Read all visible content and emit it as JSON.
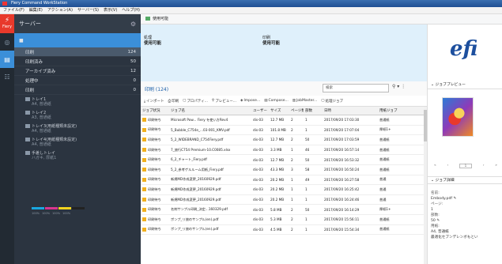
{
  "window": {
    "title": "Fiery Command WorkStation"
  },
  "menu": [
    "ファイル(F)",
    "編集(E)",
    "アクション(A)",
    "サーバー(S)",
    "表示(V)",
    "ヘルプ(H)"
  ],
  "rail": {
    "logo_label": "Fiery"
  },
  "sidebar": {
    "title": "サーバー",
    "server_name": "■",
    "items": [
      {
        "label": "印刷",
        "count": "124"
      },
      {
        "label": "印刷済み",
        "count": "50"
      },
      {
        "label": "アーカイブ済み",
        "count": "12"
      },
      {
        "label": "処理中",
        "count": "0"
      },
      {
        "label": "印刷",
        "count": "0"
      }
    ],
    "printers": [
      {
        "name": "トレイ1",
        "sub": "A4, 普通紙"
      },
      {
        "name": "トレイ2",
        "sub": "A3, 普通紙"
      },
      {
        "name": "トレイ3(用紙種類未設定)",
        "sub": "A4, 普通紙"
      },
      {
        "name": "トレイ4(用紙種類未設定)",
        "sub": "A4, 普通紙"
      },
      {
        "name": "手差しトレイ",
        "sub": "ハガキ, 厚紙1"
      }
    ],
    "ink": {
      "colors": [
        "#19a7e0",
        "#d8368f",
        "#f2d31e",
        "#222222"
      ],
      "percents": [
        "100%",
        "100%",
        "100%",
        "100%"
      ]
    }
  },
  "pathbar": {
    "label": "使用可能"
  },
  "status": [
    {
      "label": "処理",
      "value": "使用可能"
    },
    {
      "label": "印刷",
      "value": "使用可能"
    }
  ],
  "brand": "efi",
  "list": {
    "title": "印刷 (124)",
    "search_placeholder": "検索"
  },
  "toolbar": [
    {
      "icon": "⤓",
      "label": "インポート"
    },
    {
      "icon": "⎙",
      "label": "印刷"
    },
    {
      "icon": "▢",
      "label": "プロパティ..."
    },
    {
      "icon": "⚲",
      "label": "プレビュー..."
    },
    {
      "icon": "◈",
      "label": "Impose..."
    },
    {
      "icon": "▤",
      "label": "Compose..."
    },
    {
      "icon": "▥",
      "label": "JobMaster..."
    },
    {
      "icon": "▢",
      "label": "処理ジョブ"
    }
  ],
  "table": {
    "headers": [
      "ジョブ状況",
      "ジョブ名",
      "ユーザー",
      "サイズ",
      "ページ数",
      "部数",
      "日時",
      "用紙ジョブ"
    ],
    "rows": [
      [
        "印刷待ち",
        "Microsoft Pow... Fiery を使い方Rev4",
        "dis-03",
        "12.7 MB",
        "2",
        "1",
        "2017/09/20 17:03:30",
        "普通紙"
      ],
      [
        "印刷待ち",
        "5_Bubble_C754e_...03-001_KMV.pdf",
        "dis-03",
        "101.8 MB",
        "2",
        "1",
        "2017/09/20 17:07:04",
        "厚紙1+"
      ],
      [
        "印刷待ち",
        "5_2_WIDEBRAND_C754Fiery.pdf",
        "dis-03",
        "12.7 MB",
        "2",
        "50",
        "2017/09/20 17:03:59",
        "普通紙"
      ],
      [
        "印刷待ち",
        "7_旅行C754 Premium-10.C0085.xlsx",
        "dis-03",
        "3.3 MB",
        "1",
        "46",
        "2017/09/20 16:57:14",
        "普通紙"
      ],
      [
        "印刷待ち",
        "6_2_チャート_Fiery.pdf",
        "dis-03",
        "12.7 MB",
        "2",
        "50",
        "2017/09/20 16:53:32",
        "普通紙"
      ],
      [
        "印刷待ち",
        "5_2_参考ゲルルーム用紙_Fiery.pdf",
        "dis-03",
        "43.3 MB",
        "3",
        "58",
        "2017/09/20 16:50:24",
        "普通紙"
      ],
      [
        "印刷待ち",
        "新規MD作成変更_20160929.pdf",
        "dis-03",
        "20.2 MB",
        "1",
        "49",
        "2017/09/20 16:27:58",
        "普通"
      ],
      [
        "印刷待ち",
        "新規MD作成変更_20160929.pdf",
        "dis-03",
        "20.2 MB",
        "1",
        "1",
        "2017/09/20 16:25:42",
        "普通"
      ],
      [
        "印刷待ち",
        "新規MD作成変更_20160929.pdf",
        "dis-03",
        "20.2 MB",
        "1",
        "1",
        "2017/09/20 16:24:46",
        "普通"
      ],
      [
        "印刷待ち",
        "名刺サンプル印刷_決定...160329.pdf",
        "dis-03",
        "5.8 MB",
        "2",
        "50",
        "2017/09/20 16:14:29",
        "厚紙1+"
      ],
      [
        "印刷待ち",
        "ポンプ_リ旅のサンプル(en).pdf",
        "dis-03",
        "5.3 MB",
        "2",
        "1",
        "2017/09/20 15:56:11",
        "普通紙"
      ],
      [
        "印刷待ち",
        "ポンプ_リ旅のサンプル(en).pdf",
        "dis-03",
        "4.5 MB",
        "2",
        "1",
        "2017/09/20 15:54:34",
        "普通紙"
      ]
    ]
  },
  "right": {
    "preview_title": "ジョブプレビュー",
    "page": "1",
    "props_title": "ジョブ詳細",
    "props": [
      {
        "k": "名前:",
        "v": "Embody.pdf"
      },
      {
        "k": "ページ:",
        "v": "1"
      },
      {
        "k": "部数:",
        "v": "50"
      },
      {
        "k": "用紙:",
        "v": "A4, 普通紙"
      },
      {
        "k": "",
        "v": "最適化セブンデレンボもとい"
      }
    ]
  }
}
